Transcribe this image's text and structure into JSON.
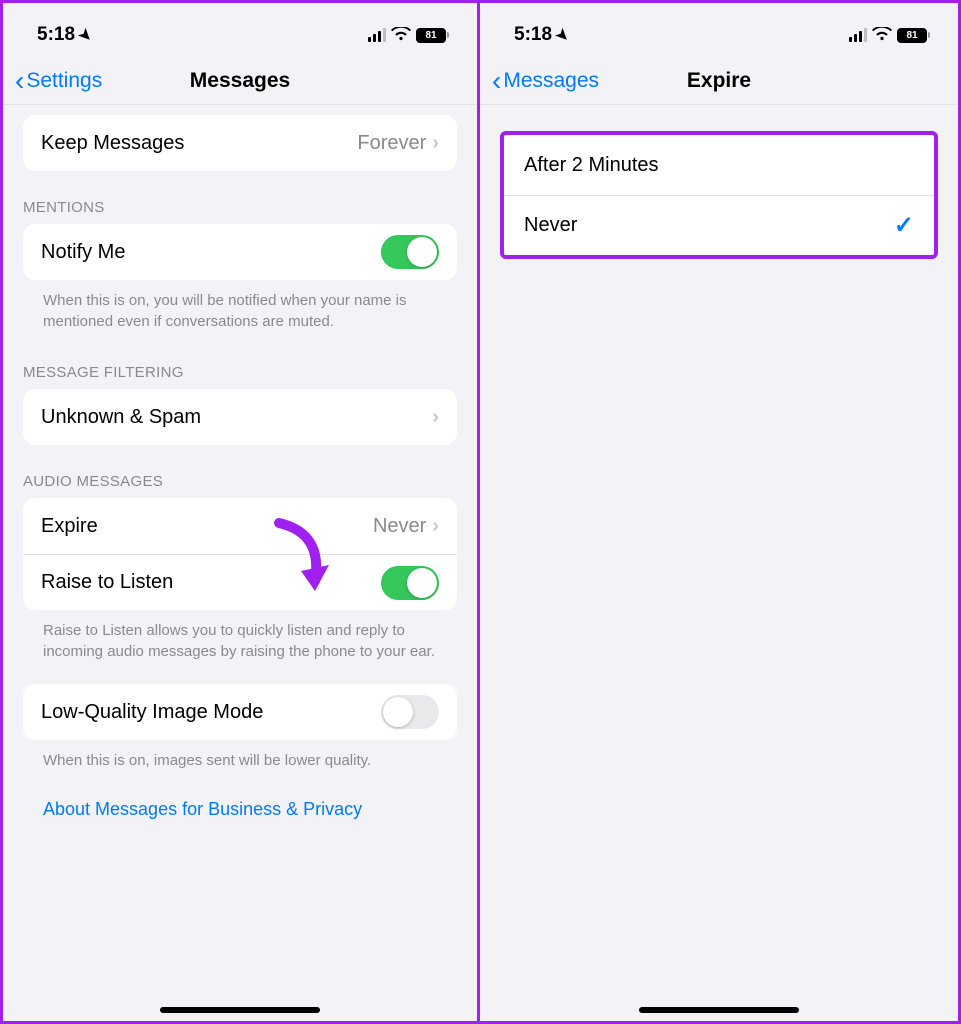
{
  "status": {
    "time": "5:18",
    "battery": "81"
  },
  "left": {
    "back_label": "Settings",
    "title": "Messages",
    "keep_messages": {
      "label": "Keep Messages",
      "value": "Forever"
    },
    "mentions_header": "MENTIONS",
    "notify_me": {
      "label": "Notify Me",
      "on": true
    },
    "notify_footer": "When this is on, you will be notified when your name is mentioned even if conversations are muted.",
    "filtering_header": "MESSAGE FILTERING",
    "unknown_spam": {
      "label": "Unknown & Spam"
    },
    "audio_header": "AUDIO MESSAGES",
    "expire": {
      "label": "Expire",
      "value": "Never"
    },
    "raise": {
      "label": "Raise to Listen",
      "on": true
    },
    "raise_footer": "Raise to Listen allows you to quickly listen and reply to incoming audio messages by raising the phone to your ear.",
    "low_quality": {
      "label": "Low-Quality Image Mode",
      "on": false
    },
    "low_quality_footer": "When this is on, images sent will be lower quality.",
    "about_link": "About Messages for Business & Privacy"
  },
  "right": {
    "back_label": "Messages",
    "title": "Expire",
    "options": [
      {
        "label": "After 2 Minutes",
        "selected": false
      },
      {
        "label": "Never",
        "selected": true
      }
    ]
  }
}
